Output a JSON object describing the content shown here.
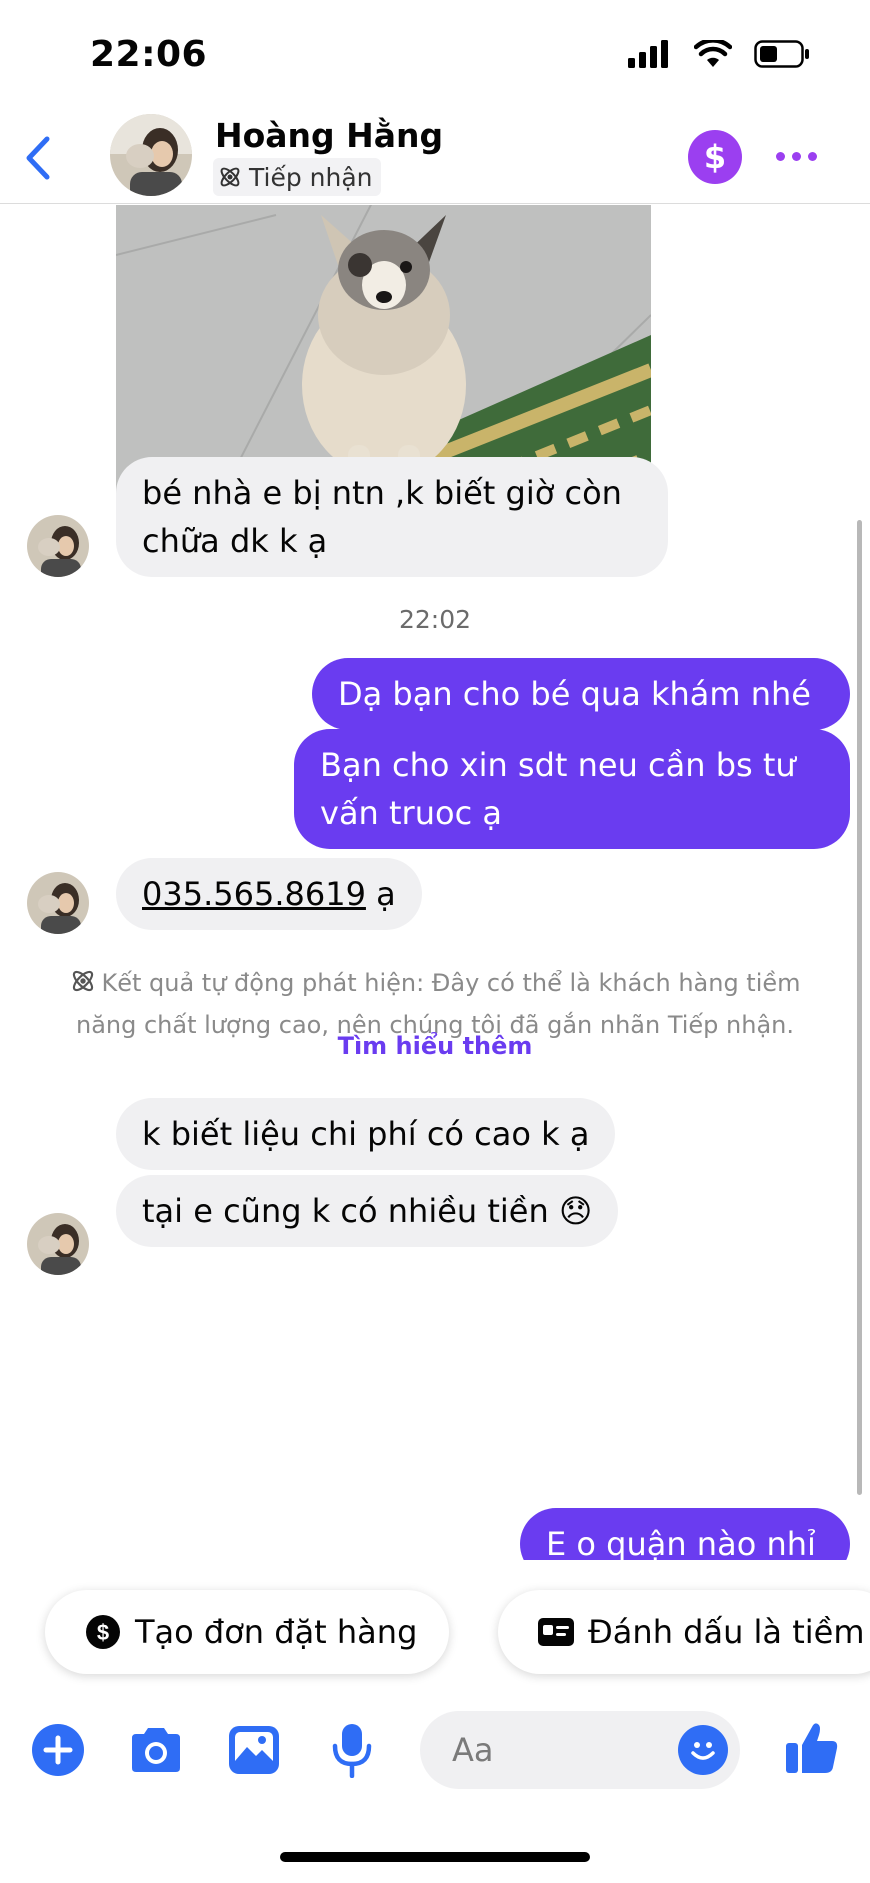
{
  "status_bar": {
    "time": "22:06"
  },
  "header": {
    "contact_name": "Hoàng Hằng",
    "label": "Tiếp nhận",
    "colors": {
      "accent": "#9b3ff0",
      "back": "#2f6df5"
    }
  },
  "messages": {
    "msg1": "bé nhà e bị ntn ,k biết giờ còn chữa dk k ạ",
    "timestamp": "22:02",
    "msg2": "Dạ bạn cho bé qua khám nhé",
    "msg3": "Bạn cho xin sdt neu cần bs tư vấn truoc ạ",
    "msg4_phone": "035.565.8619",
    "msg4_suffix": " ạ",
    "system_note": "Kết quả tự động phát hiện: Đây có thể là khách hàng tiềm năng chất lượng cao, nên chúng tôi đã gắn nhãn Tiếp nhận.",
    "system_link": "Tìm hiểu thêm",
    "msg5": "k biết liệu chi phí có cao k ạ",
    "msg6": "tại e cũng k có nhiều tiền 😞",
    "msg7": "E o quận nào nhỉ",
    "colors": {
      "outgoing": "#6a3cf0",
      "incoming": "#f0f0f2"
    }
  },
  "quick_actions": {
    "create_order": "Tạo đơn đặt hàng",
    "mark_lead": "Đánh dấu là tiềm"
  },
  "composer": {
    "placeholder": "Aa"
  }
}
